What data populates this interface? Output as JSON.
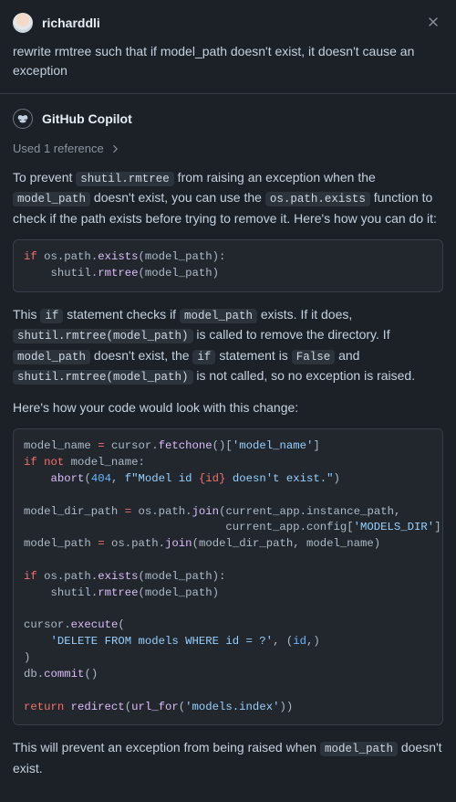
{
  "user": {
    "name": "richarddli"
  },
  "prompt": "rewrite rmtree such that if model_path doesn't exist, it doesn't cause an exception",
  "assistant": {
    "name": "GitHub Copilot",
    "references_label": "Used 1 reference"
  },
  "response": {
    "p1_before1": "To prevent ",
    "p1_code1": "shutil.rmtree",
    "p1_between1": " from raising an exception when the ",
    "p1_code2": "model_path",
    "p1_between2": " doesn't exist, you can use the ",
    "p1_code3": "os.path.exists",
    "p1_after": " function to check if the path exists before trying to remove it. Here's how you can do it:",
    "p2_before1": "This ",
    "p2_code1": "if",
    "p2_between1": " statement checks if ",
    "p2_code2": "model_path",
    "p2_between2": " exists. If it does, ",
    "p2_code3": "shutil.rmtree(model_path)",
    "p2_between3": " is called to remove the directory. If ",
    "p2_code4": "model_path",
    "p2_between4": " doesn't exist, the ",
    "p2_code5": "if",
    "p2_between5": " statement is ",
    "p2_code6": "False",
    "p2_between6": " and ",
    "p2_code7": "shutil.rmtree(model_path)",
    "p2_after": " is not called, so no exception is raised.",
    "p3": "Here's how your code would look with this change:",
    "p4_before": "This will prevent an exception from being raised when ",
    "p4_code": "model_path",
    "p4_after": " doesn't exist."
  },
  "code1": {
    "tokens": [
      {
        "t": "if ",
        "c": "tok-k"
      },
      {
        "t": "os",
        "c": "tok-p"
      },
      {
        "t": ".",
        "c": "tok-p"
      },
      {
        "t": "path",
        "c": "tok-p"
      },
      {
        "t": ".",
        "c": "tok-p"
      },
      {
        "t": "exists",
        "c": "tok-fn"
      },
      {
        "t": "(model_path):",
        "c": "tok-p"
      },
      {
        "t": "\n    ",
        "c": "tok-p"
      },
      {
        "t": "shutil",
        "c": "tok-p"
      },
      {
        "t": ".",
        "c": "tok-p"
      },
      {
        "t": "rmtree",
        "c": "tok-fn"
      },
      {
        "t": "(model_path)",
        "c": "tok-p"
      }
    ]
  },
  "code2": {
    "tokens": [
      {
        "t": "model_name ",
        "c": "tok-p"
      },
      {
        "t": "=",
        "c": "tok-k"
      },
      {
        "t": " cursor",
        "c": "tok-p"
      },
      {
        "t": ".",
        "c": "tok-p"
      },
      {
        "t": "fetchone",
        "c": "tok-fn"
      },
      {
        "t": "()[",
        "c": "tok-p"
      },
      {
        "t": "'model_name'",
        "c": "tok-s"
      },
      {
        "t": "]",
        "c": "tok-p"
      },
      {
        "t": "\n",
        "c": "tok-p"
      },
      {
        "t": "if not ",
        "c": "tok-k"
      },
      {
        "t": "model_name:",
        "c": "tok-p"
      },
      {
        "t": "\n    ",
        "c": "tok-p"
      },
      {
        "t": "abort",
        "c": "tok-fn"
      },
      {
        "t": "(",
        "c": "tok-p"
      },
      {
        "t": "404",
        "c": "tok-n"
      },
      {
        "t": ", ",
        "c": "tok-p"
      },
      {
        "t": "f\"Model id ",
        "c": "tok-s"
      },
      {
        "t": "{id}",
        "c": "tok-k"
      },
      {
        "t": " doesn't exist.\"",
        "c": "tok-s"
      },
      {
        "t": ")",
        "c": "tok-p"
      },
      {
        "t": "\n\n",
        "c": "tok-p"
      },
      {
        "t": "model_dir_path ",
        "c": "tok-p"
      },
      {
        "t": "=",
        "c": "tok-k"
      },
      {
        "t": " os",
        "c": "tok-p"
      },
      {
        "t": ".",
        "c": "tok-p"
      },
      {
        "t": "path",
        "c": "tok-p"
      },
      {
        "t": ".",
        "c": "tok-p"
      },
      {
        "t": "join",
        "c": "tok-fn"
      },
      {
        "t": "(current_app",
        "c": "tok-p"
      },
      {
        "t": ".",
        "c": "tok-p"
      },
      {
        "t": "instance_path,",
        "c": "tok-p"
      },
      {
        "t": "\n                              ",
        "c": "tok-p"
      },
      {
        "t": "current_app",
        "c": "tok-p"
      },
      {
        "t": ".",
        "c": "tok-p"
      },
      {
        "t": "config[",
        "c": "tok-p"
      },
      {
        "t": "'MODELS_DIR'",
        "c": "tok-s"
      },
      {
        "t": "])",
        "c": "tok-p"
      },
      {
        "t": "\n",
        "c": "tok-p"
      },
      {
        "t": "model_path ",
        "c": "tok-p"
      },
      {
        "t": "=",
        "c": "tok-k"
      },
      {
        "t": " os",
        "c": "tok-p"
      },
      {
        "t": ".",
        "c": "tok-p"
      },
      {
        "t": "path",
        "c": "tok-p"
      },
      {
        "t": ".",
        "c": "tok-p"
      },
      {
        "t": "join",
        "c": "tok-fn"
      },
      {
        "t": "(model_dir_path, model_name)",
        "c": "tok-p"
      },
      {
        "t": "\n\n",
        "c": "tok-p"
      },
      {
        "t": "if ",
        "c": "tok-k"
      },
      {
        "t": "os",
        "c": "tok-p"
      },
      {
        "t": ".",
        "c": "tok-p"
      },
      {
        "t": "path",
        "c": "tok-p"
      },
      {
        "t": ".",
        "c": "tok-p"
      },
      {
        "t": "exists",
        "c": "tok-fn"
      },
      {
        "t": "(model_path):",
        "c": "tok-p"
      },
      {
        "t": "\n    ",
        "c": "tok-p"
      },
      {
        "t": "shutil",
        "c": "tok-p"
      },
      {
        "t": ".",
        "c": "tok-p"
      },
      {
        "t": "rmtree",
        "c": "tok-fn"
      },
      {
        "t": "(model_path)",
        "c": "tok-p"
      },
      {
        "t": "\n\n",
        "c": "tok-p"
      },
      {
        "t": "cursor",
        "c": "tok-p"
      },
      {
        "t": ".",
        "c": "tok-p"
      },
      {
        "t": "execute",
        "c": "tok-fn"
      },
      {
        "t": "(",
        "c": "tok-p"
      },
      {
        "t": "\n    ",
        "c": "tok-p"
      },
      {
        "t": "'DELETE FROM models WHERE id = ?'",
        "c": "tok-s"
      },
      {
        "t": ", (",
        "c": "tok-p"
      },
      {
        "t": "id",
        "c": "tok-b"
      },
      {
        "t": ",)",
        "c": "tok-p"
      },
      {
        "t": "\n",
        "c": "tok-p"
      },
      {
        "t": ")",
        "c": "tok-p"
      },
      {
        "t": "\n",
        "c": "tok-p"
      },
      {
        "t": "db",
        "c": "tok-p"
      },
      {
        "t": ".",
        "c": "tok-p"
      },
      {
        "t": "commit",
        "c": "tok-fn"
      },
      {
        "t": "()",
        "c": "tok-p"
      },
      {
        "t": "\n\n",
        "c": "tok-p"
      },
      {
        "t": "return ",
        "c": "tok-k"
      },
      {
        "t": "redirect",
        "c": "tok-fn"
      },
      {
        "t": "(",
        "c": "tok-p"
      },
      {
        "t": "url_for",
        "c": "tok-fn"
      },
      {
        "t": "(",
        "c": "tok-p"
      },
      {
        "t": "'models.index'",
        "c": "tok-s"
      },
      {
        "t": "))",
        "c": "tok-p"
      }
    ]
  }
}
